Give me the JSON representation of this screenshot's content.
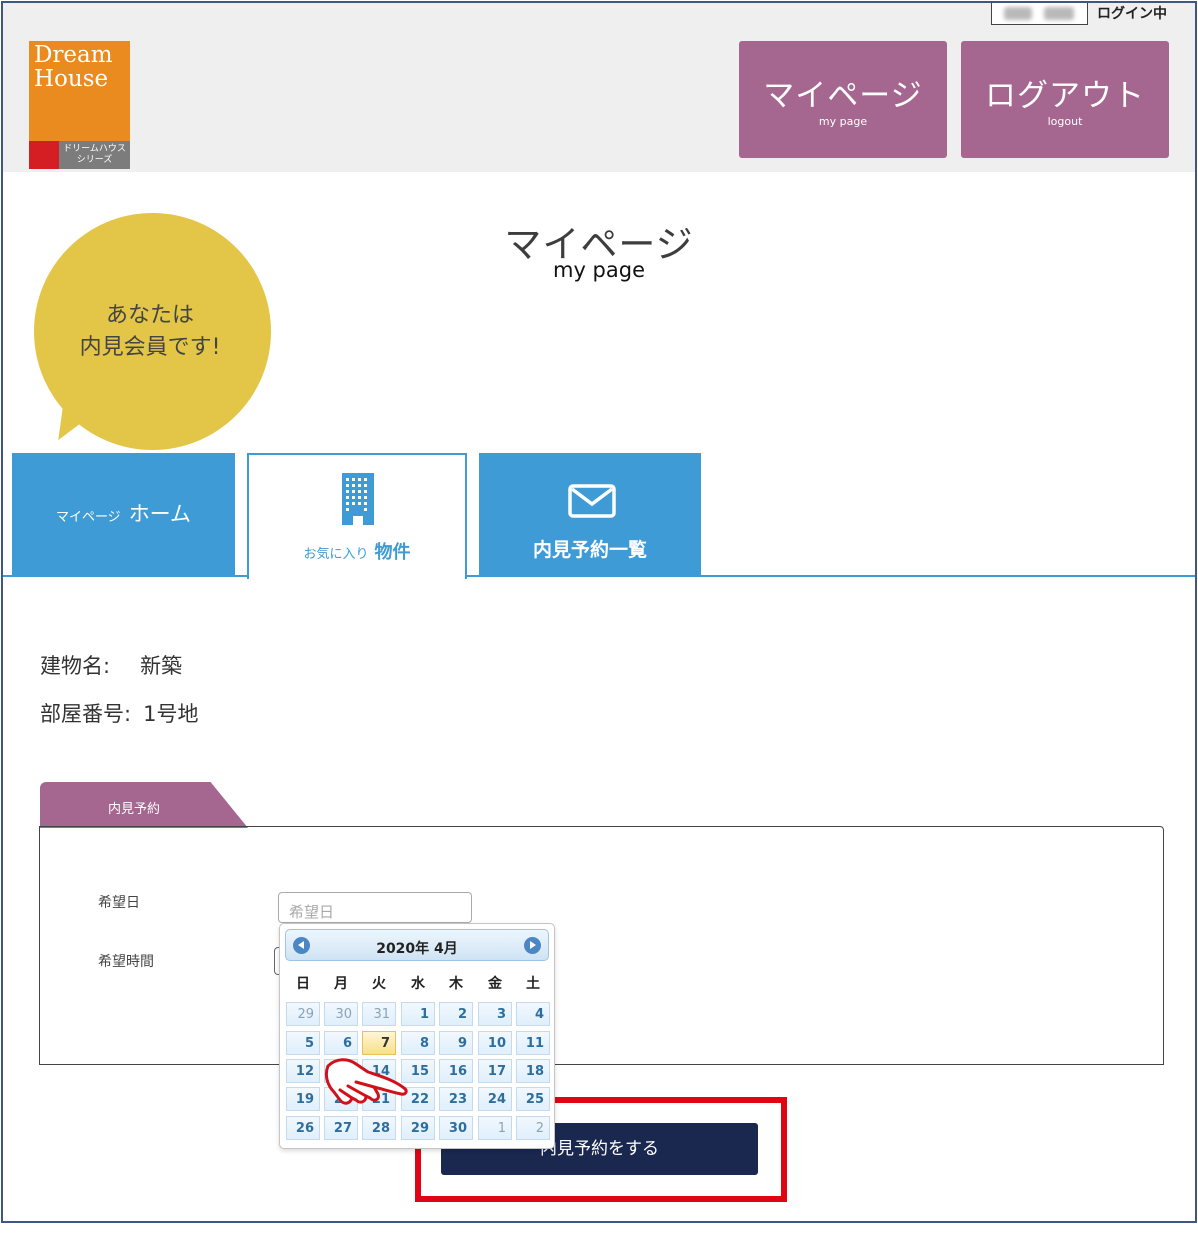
{
  "header": {
    "login_status": "ログイン中",
    "logo": {
      "line1": "Dream",
      "line2": "House",
      "sub1": "ドリームハウス",
      "sub2": "シリーズ"
    },
    "mypage_button": {
      "label": "マイページ",
      "sub": "my page"
    },
    "logout_button": {
      "label": "ログアウト",
      "sub": "logout"
    }
  },
  "bubble": {
    "line1": "あなたは",
    "line2": "内見会員です!"
  },
  "page": {
    "title": "マイページ",
    "subtitle": "my page"
  },
  "tabs": {
    "home": {
      "small": "マイページ",
      "big": "ホーム"
    },
    "favorites": {
      "small": "お気に入り",
      "big": "物件",
      "icon": "building-icon"
    },
    "reservations": {
      "label": "内見予約一覧",
      "icon": "mail-icon"
    }
  },
  "property": {
    "building_label": "建物名:",
    "building_value": "新築",
    "room_label": "部屋番号:",
    "room_value": "1号地"
  },
  "reservation": {
    "tab_label": "内見予約",
    "date_label": "希望日",
    "date_placeholder": "希望日",
    "time_label": "希望時間",
    "submit_label": "内見予約をする"
  },
  "calendar": {
    "title": "2020年 4月",
    "weekdays": [
      "日",
      "月",
      "火",
      "水",
      "木",
      "金",
      "土"
    ],
    "weeks": [
      [
        {
          "d": "29",
          "o": true
        },
        {
          "d": "30",
          "o": true
        },
        {
          "d": "31",
          "o": true
        },
        {
          "d": "1"
        },
        {
          "d": "2"
        },
        {
          "d": "3"
        },
        {
          "d": "4"
        }
      ],
      [
        {
          "d": "5"
        },
        {
          "d": "6"
        },
        {
          "d": "7",
          "today": true
        },
        {
          "d": "8"
        },
        {
          "d": "9"
        },
        {
          "d": "10"
        },
        {
          "d": "11"
        }
      ],
      [
        {
          "d": "12"
        },
        {
          "d": "13"
        },
        {
          "d": "14"
        },
        {
          "d": "15"
        },
        {
          "d": "16"
        },
        {
          "d": "17"
        },
        {
          "d": "18"
        }
      ],
      [
        {
          "d": "19"
        },
        {
          "d": "20"
        },
        {
          "d": "21"
        },
        {
          "d": "22"
        },
        {
          "d": "23"
        },
        {
          "d": "24"
        },
        {
          "d": "25"
        }
      ],
      [
        {
          "d": "26"
        },
        {
          "d": "27"
        },
        {
          "d": "28"
        },
        {
          "d": "29"
        },
        {
          "d": "30"
        },
        {
          "d": "1",
          "o": true
        },
        {
          "d": "2",
          "o": true
        }
      ]
    ]
  },
  "colors": {
    "header_bg": "#efefef",
    "accent_purple": "#a5668f",
    "tab_blue": "#3e9bd6",
    "bubble_yellow": "#e3c647",
    "submit_navy": "#1a2850",
    "highlight_red": "#e00514"
  }
}
